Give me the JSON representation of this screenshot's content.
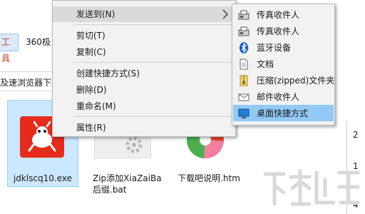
{
  "explorer": {
    "tab_tools_label": "工具",
    "tab_360_label": "360极",
    "address_text": "及速浏览器下载",
    "files": [
      {
        "name": "jdklscq10.exe",
        "selected": true
      },
      {
        "name": "Zip添加XiaZaiBa后缀.bat",
        "selected": false
      },
      {
        "name": "下载吧说明.htm",
        "selected": false
      }
    ],
    "right_panel": {
      "top_char": "2",
      "mid_char": "1",
      "bottom_char": "4"
    }
  },
  "context_menu": {
    "items": [
      {
        "label": "发送到(N)",
        "has_submenu": true,
        "highlighted": true
      },
      {
        "label": "剪切(T)"
      },
      {
        "label": "复制(C)"
      },
      {
        "label": "创建快捷方式(S)"
      },
      {
        "label": "删除(D)"
      },
      {
        "label": "重命名(M)"
      },
      {
        "label": "属性(R)"
      }
    ]
  },
  "send_to_menu": {
    "items": [
      {
        "label": "传真收件人",
        "icon": "fax-icon"
      },
      {
        "label": "传真收件人",
        "icon": "fax-icon"
      },
      {
        "label": "蓝牙设备",
        "icon": "bluetooth-icon"
      },
      {
        "label": "文档",
        "icon": "document-icon"
      },
      {
        "label": "压缩(zipped)文件夹",
        "icon": "zip-folder-icon"
      },
      {
        "label": "邮件收件人",
        "icon": "mail-icon"
      },
      {
        "label": "桌面快捷方式",
        "icon": "desktop-icon",
        "highlighted": true
      }
    ]
  },
  "colors": {
    "selection_bg": "#cce8ff",
    "submenu_highlight": "#91c9f7",
    "app_icon_red": "#e52c1c",
    "bluetooth_blue": "#0a5cc2"
  }
}
